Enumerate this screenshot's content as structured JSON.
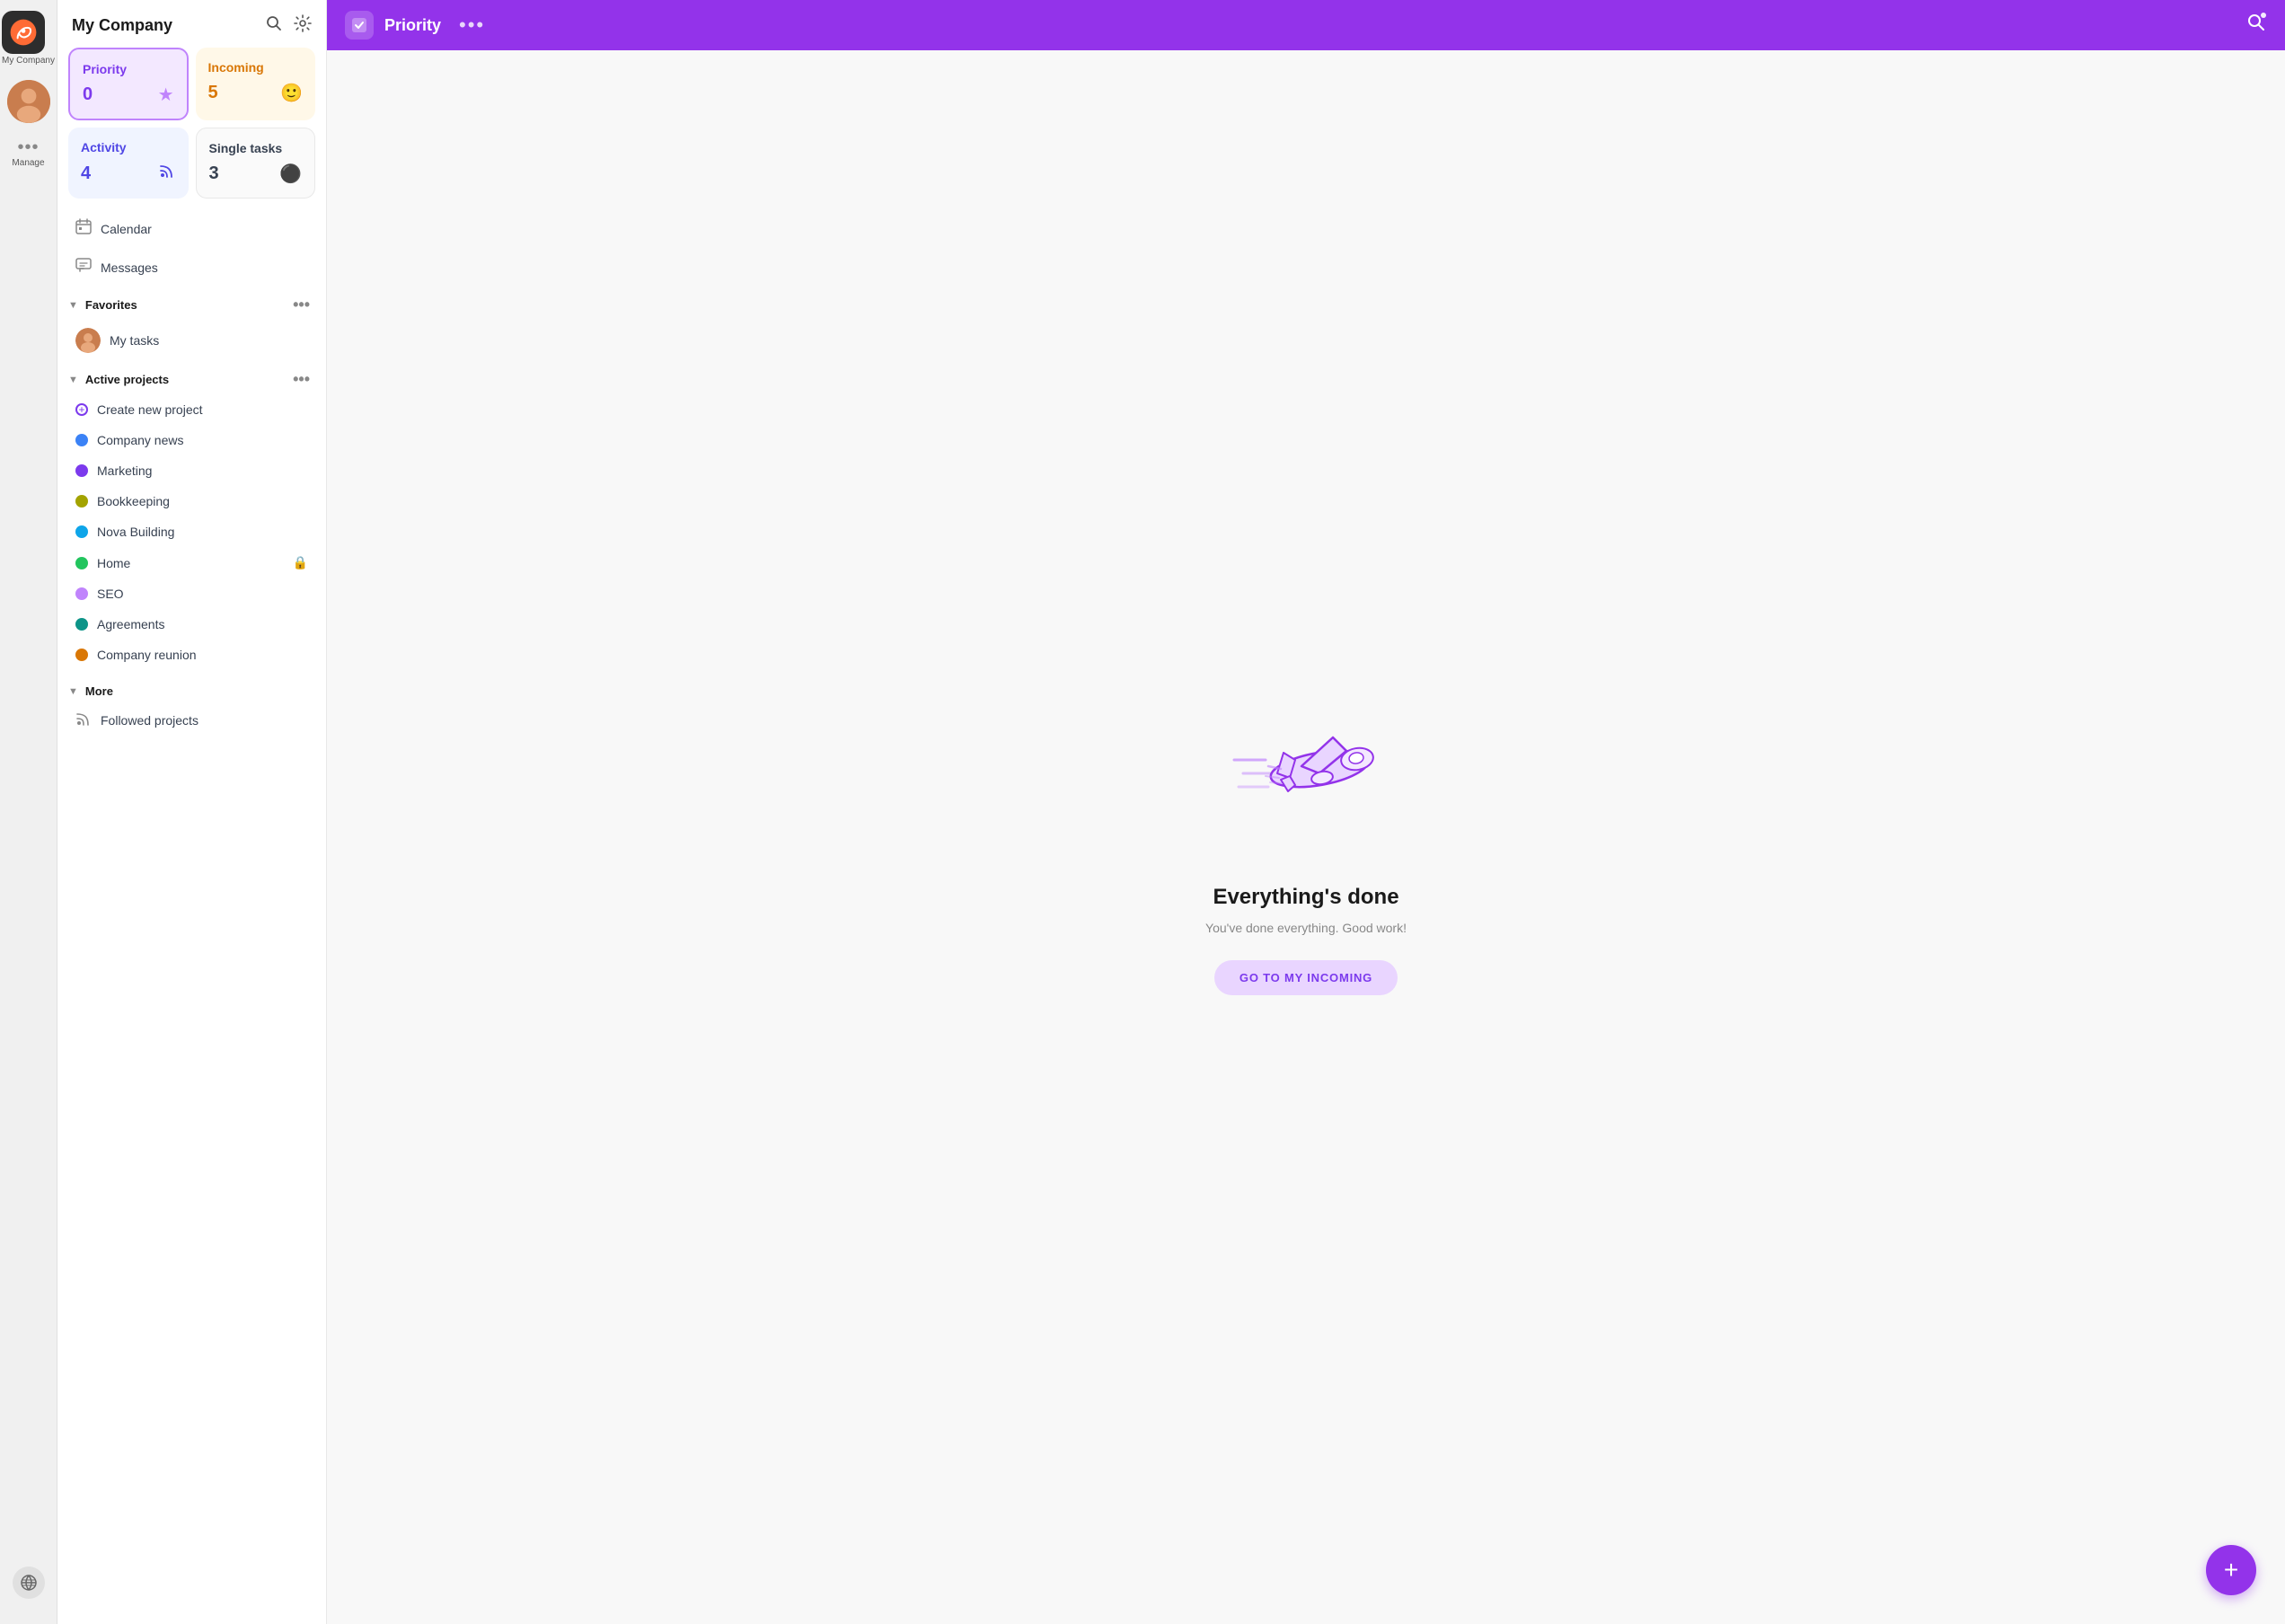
{
  "rail": {
    "app_name": "My Company",
    "manage_label": "Manage"
  },
  "sidebar": {
    "title": "My Company",
    "search_title": "Search",
    "settings_title": "Settings",
    "cards": [
      {
        "id": "priority",
        "label": "Priority",
        "count": "0",
        "icon": "★"
      },
      {
        "id": "incoming",
        "label": "Incoming",
        "count": "5",
        "icon": "😊"
      },
      {
        "id": "activity",
        "label": "Activity",
        "count": "4",
        "icon": "📡"
      },
      {
        "id": "single",
        "label": "Single tasks",
        "count": "3",
        "icon": "⚫"
      }
    ],
    "nav": [
      {
        "id": "calendar",
        "label": "Calendar",
        "icon": "📅"
      },
      {
        "id": "messages",
        "label": "Messages",
        "icon": "💬"
      }
    ],
    "favorites_label": "Favorites",
    "favorites_items": [
      {
        "id": "my-tasks",
        "label": "My tasks",
        "avatar": true
      }
    ],
    "active_projects_label": "Active projects",
    "create_project_label": "Create new project",
    "projects": [
      {
        "id": "company-news",
        "label": "Company news",
        "color": "#3b82f6"
      },
      {
        "id": "marketing",
        "label": "Marketing",
        "color": "#7c3aed"
      },
      {
        "id": "bookkeeping",
        "label": "Bookkeeping",
        "color": "#a3a300"
      },
      {
        "id": "nova-building",
        "label": "Nova Building",
        "color": "#0ea5e9"
      },
      {
        "id": "home",
        "label": "Home",
        "color": "#22c55e",
        "badge": "🔒"
      },
      {
        "id": "seo",
        "label": "SEO",
        "color": "#c084fc"
      },
      {
        "id": "agreements",
        "label": "Agreements",
        "color": "#0d9488"
      },
      {
        "id": "company-reunion",
        "label": "Company reunion",
        "color": "#d97706"
      }
    ],
    "more_label": "More",
    "more_items": [
      {
        "id": "followed-projects",
        "label": "Followed projects",
        "icon": "📡"
      }
    ]
  },
  "topbar": {
    "title": "Priority",
    "more_icon": "•••"
  },
  "main": {
    "illustration_alt": "Airplane illustration",
    "heading": "Everything's done",
    "subtext": "You've done everything. Good work!",
    "cta_label": "GO TO MY INCOMING"
  },
  "fab": {
    "label": "+"
  }
}
